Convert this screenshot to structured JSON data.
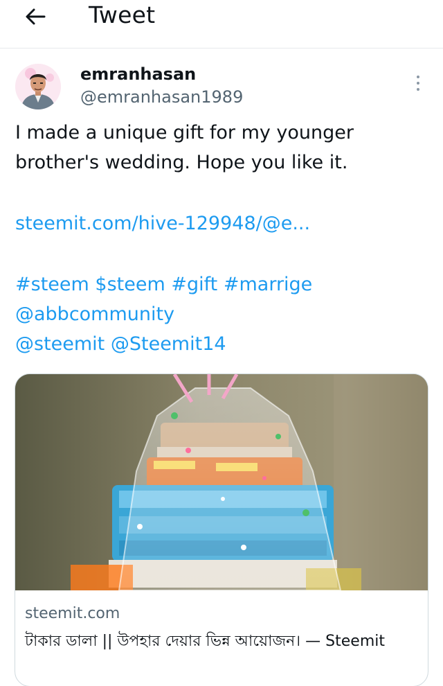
{
  "header": {
    "title": "Tweet",
    "back_icon": "arrow-left-icon"
  },
  "author": {
    "display_name": "emranhasan",
    "handle": "@emranhasan1989",
    "avatar_icon": "avatar-illustration"
  },
  "tweet": {
    "text_lines": [
      "I made a unique gift for my younger",
      "brother's wedding. Hope you like it."
    ],
    "link": "steemit.com/hive-129948/@e...",
    "tags": [
      "#steem",
      "$steem",
      "#gift",
      "#marrige",
      "@abbcommunity",
      "@steemit",
      "@Steemit14"
    ]
  },
  "card": {
    "domain": "steemit.com",
    "title": "টাকার ডালা || উপহার দেয়ার ভিন্ন আয়োজন। — Steemit",
    "image_icon": "gift-basket-photo"
  },
  "colors": {
    "link": "#1d9bf0",
    "text": "#0f1419",
    "muted": "#536471",
    "border": "#cfd9de"
  }
}
